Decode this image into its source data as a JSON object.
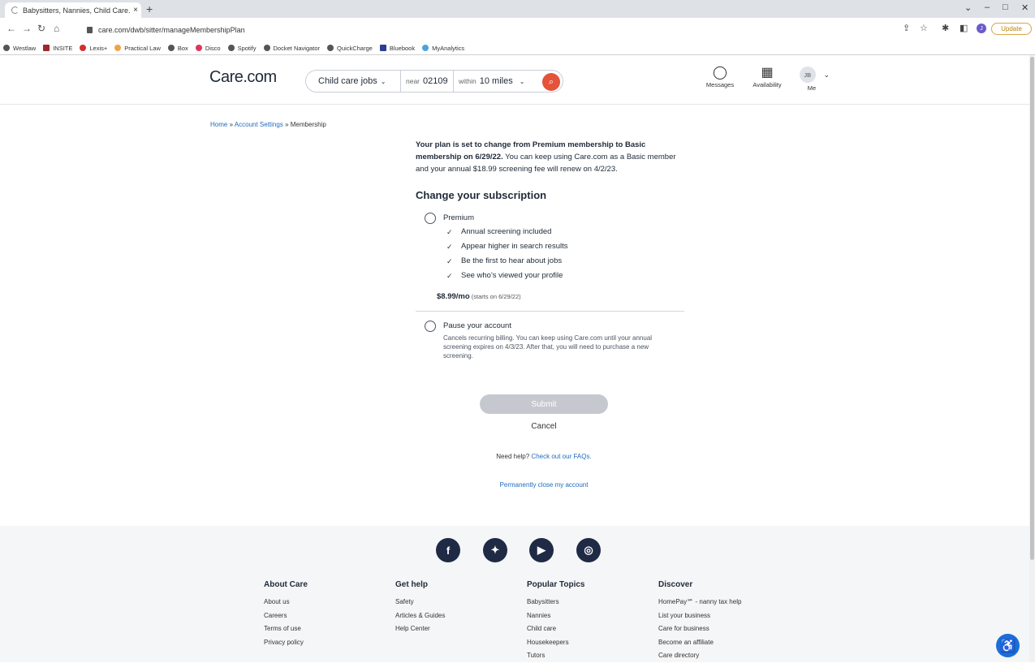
{
  "browser": {
    "tab_title": "Babysitters, Nannies, Child Care.",
    "tab_close": "×",
    "new_tab": "+",
    "url": "care.com/dwb/sitter/manageMembershipPlan",
    "update_label": "Update",
    "profile_initial": "J",
    "bookmarks": [
      "Westlaw",
      "INSITE",
      "Lexis+",
      "Practical Law",
      "Box",
      "Disco",
      "Spotify",
      "Docket Navigator",
      "QuickCharge",
      "Bluebook",
      "MyAnalytics"
    ]
  },
  "header": {
    "logo": "Care.com",
    "search": {
      "jobs_label": "Child care jobs",
      "near_label": "near",
      "zip": "02109",
      "within_label": "within",
      "radius": "10 miles"
    },
    "nav": {
      "messages": "Messages",
      "availability": "Availability",
      "me_initials": "JB",
      "me": "Me"
    }
  },
  "breadcrumb": {
    "home": "Home",
    "sep1": " » ",
    "account": "Account Settings",
    "sep2": " » ",
    "current": "Membership"
  },
  "notice": {
    "bold": "Your plan is set to change from Premium membership to Basic membership on 6/29/22.",
    "rest": " You can keep using Care.com as a Basic member and your annual $18.99 screening fee will renew on 4/2/23."
  },
  "subscription": {
    "heading": "Change your subscription",
    "premium": {
      "title": "Premium",
      "features": [
        "Annual screening included",
        "Appear higher in search results",
        "Be the first to hear about jobs",
        "See who's viewed your profile"
      ],
      "price": "$8.99/mo",
      "price_note": " (starts on 6/29/22)"
    },
    "pause": {
      "title": "Pause your account",
      "description": "Cancels recurring billing. You can keep using Care.com until your annual screening expires on 4/3/23. After that, you will need to purchase a new screening."
    },
    "submit_label": "Submit",
    "cancel_label": "Cancel"
  },
  "help": {
    "text": "Need help? ",
    "link": "Check out our FAQs."
  },
  "close_account": "Permanently close my account",
  "footer": {
    "social": [
      "facebook-icon",
      "twitter-icon",
      "youtube-icon",
      "instagram-icon"
    ],
    "columns": [
      {
        "heading": "About Care",
        "links": [
          "About us",
          "Careers",
          "Terms of use",
          "Privacy policy"
        ]
      },
      {
        "heading": "Get help",
        "links": [
          "Safety",
          "Articles & Guides",
          "Help Center"
        ]
      },
      {
        "heading": "Popular Topics",
        "links": [
          "Babysitters",
          "Nannies",
          "Child care",
          "Housekeepers",
          "Tutors"
        ]
      },
      {
        "heading": "Discover",
        "links": [
          "HomePay℠ - nanny tax help",
          "List your business",
          "Care for business",
          "Become an affiliate",
          "Care directory"
        ]
      }
    ]
  },
  "colors": {
    "accent": "#e5533a",
    "link": "#1f6bbf",
    "footer_bg": "#f5f6f7",
    "submit_disabled": "#c5c9cf"
  }
}
